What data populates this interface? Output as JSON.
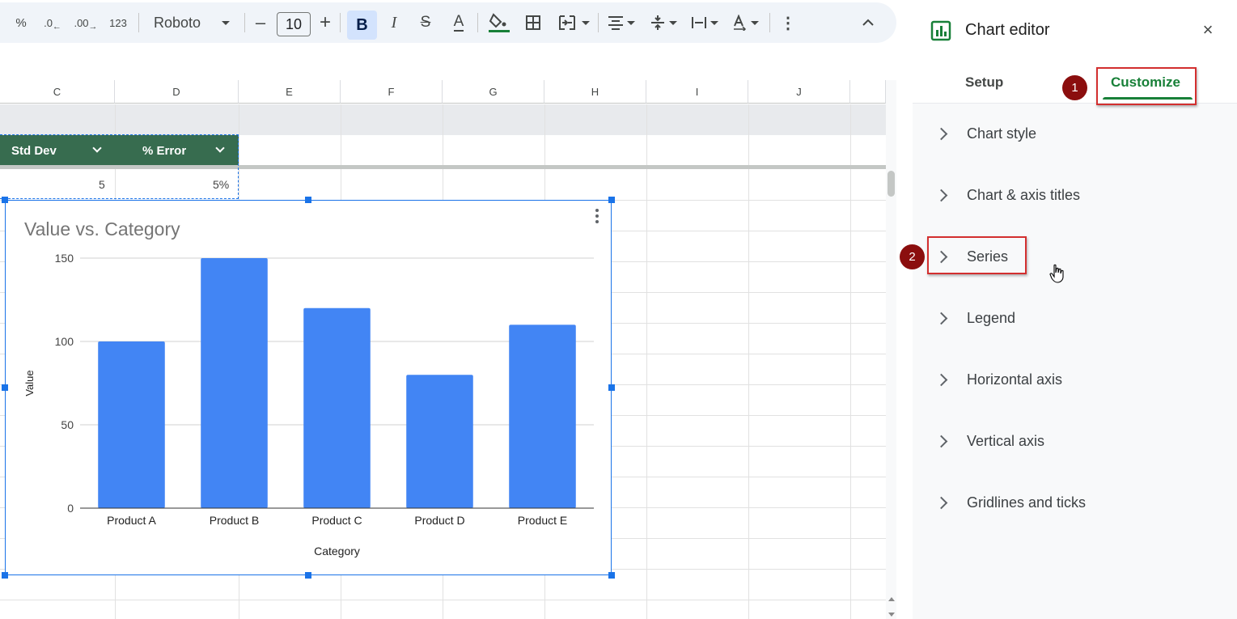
{
  "toolbar": {
    "percent": "%",
    "dec_decrease": ".0",
    "dec_increase": ".00",
    "number_format": "123",
    "font": "Roboto",
    "minus": "–",
    "font_size": "10",
    "plus": "+",
    "bold": "B",
    "italic": "I",
    "strike": "S",
    "text_color": "A",
    "more": "⋮",
    "collapse": "^"
  },
  "grid": {
    "columns": [
      "C",
      "D",
      "E",
      "F",
      "G",
      "H",
      "I",
      "J"
    ],
    "header_cells": [
      {
        "label": "Std Dev"
      },
      {
        "label": "% Error"
      }
    ],
    "row1": {
      "std_dev": "5",
      "pct_error": "5%"
    }
  },
  "chart_data": {
    "type": "bar",
    "title": "Value vs. Category",
    "xlabel": "Category",
    "ylabel": "Value",
    "categories": [
      "Product A",
      "Product B",
      "Product C",
      "Product D",
      "Product E"
    ],
    "values": [
      100,
      150,
      120,
      80,
      110
    ],
    "ylim": [
      0,
      150
    ],
    "yticks": [
      "0",
      "50",
      "100",
      "150"
    ],
    "bar_color": "#4285f4",
    "grid": true
  },
  "panel": {
    "title": "Chart editor",
    "close": "×",
    "tabs": [
      {
        "label": "Setup",
        "active": false
      },
      {
        "label": "Customize",
        "active": true
      }
    ],
    "sections": [
      {
        "label": "Chart style"
      },
      {
        "label": "Chart & axis titles"
      },
      {
        "label": "Series"
      },
      {
        "label": "Legend"
      },
      {
        "label": "Horizontal axis"
      },
      {
        "label": "Vertical axis"
      },
      {
        "label": "Gridlines and ticks"
      }
    ],
    "markers": [
      "1",
      "2"
    ],
    "accent": "#188038",
    "highlight": "#d32f2f"
  }
}
